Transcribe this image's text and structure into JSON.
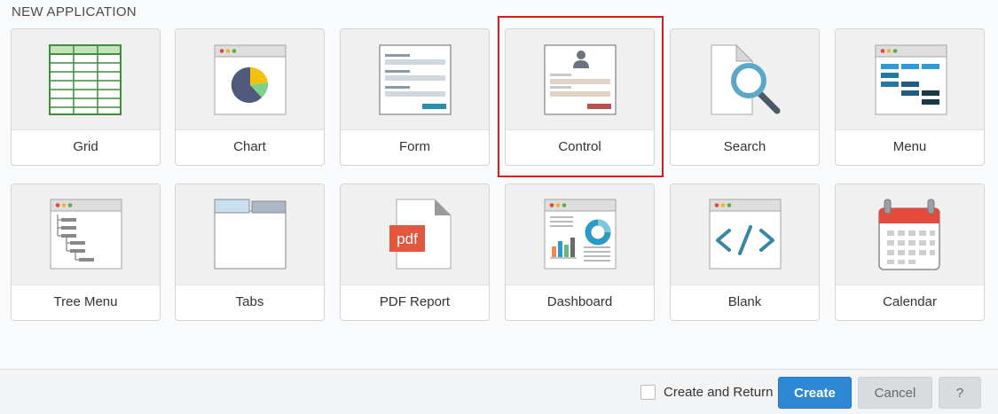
{
  "header": {
    "title": "NEW APPLICATION"
  },
  "apps": [
    {
      "label": "Grid",
      "icon": "grid-icon"
    },
    {
      "label": "Chart",
      "icon": "chart-icon"
    },
    {
      "label": "Form",
      "icon": "form-icon"
    },
    {
      "label": "Control",
      "icon": "control-icon",
      "selected": true
    },
    {
      "label": "Search",
      "icon": "search-icon"
    },
    {
      "label": "Menu",
      "icon": "menu-icon"
    },
    {
      "label": "Tree Menu",
      "icon": "tree-menu-icon"
    },
    {
      "label": "Tabs",
      "icon": "tabs-icon"
    },
    {
      "label": "PDF Report",
      "icon": "pdf-report-icon"
    },
    {
      "label": "Dashboard",
      "icon": "dashboard-icon"
    },
    {
      "label": "Blank",
      "icon": "blank-icon"
    },
    {
      "label": "Calendar",
      "icon": "calendar-icon"
    }
  ],
  "footer": {
    "create_and_return_label": "Create and Return",
    "create_and_return_checked": false,
    "create_label": "Create",
    "cancel_label": "Cancel",
    "help_label": "?"
  },
  "colors": {
    "accent": "#2e88d3",
    "highlight": "#e0161e"
  }
}
